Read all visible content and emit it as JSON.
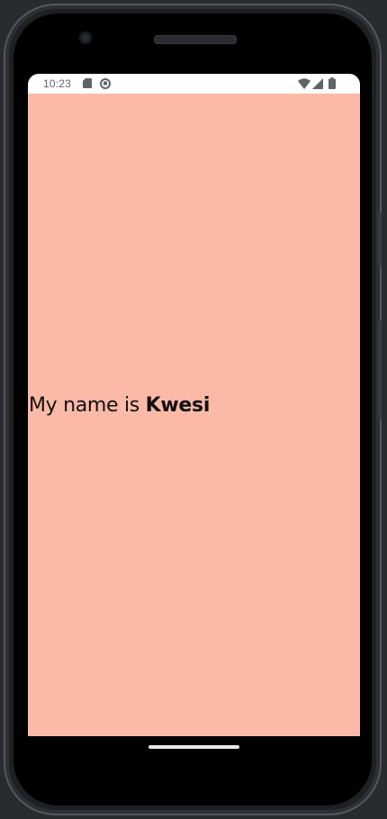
{
  "status_bar": {
    "time": "10:23",
    "icons": [
      "sd-card-icon",
      "data-saver-icon",
      "wifi-icon",
      "cell-signal-icon",
      "battery-icon"
    ]
  },
  "screen": {
    "background_color": "#fbbaa7",
    "text_prefix": "My name is ",
    "name": "Kwesi"
  },
  "nav_bar": {
    "home_indicator": "home-pill"
  }
}
